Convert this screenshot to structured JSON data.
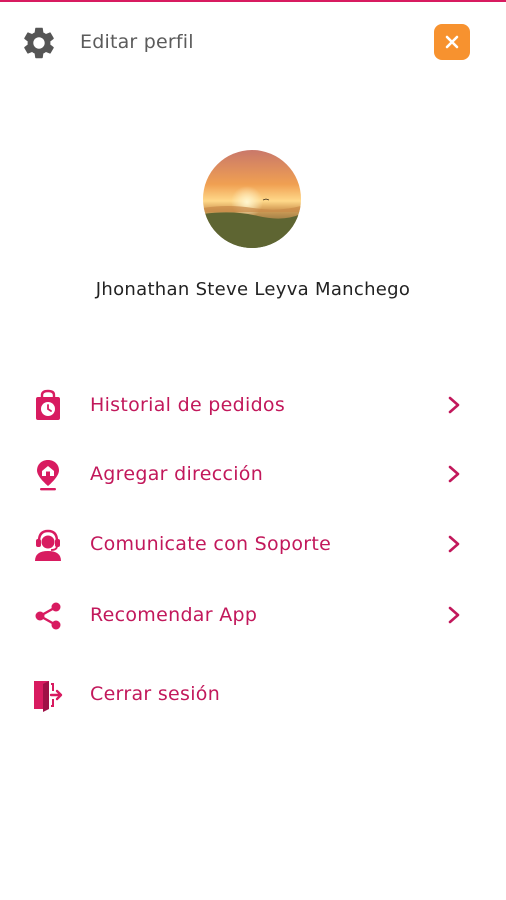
{
  "header": {
    "edit_profile_label": "Editar perfil",
    "settings_icon": "gear-icon",
    "close_icon": "close-icon"
  },
  "profile": {
    "name": "Jhonathan Steve Leyva Manchego",
    "avatar": "sunset-avatar"
  },
  "menu": {
    "items": [
      {
        "label": "Historial de pedidos",
        "icon": "shopping-bag-clock-icon"
      },
      {
        "label": "Agregar dirección",
        "icon": "home-pin-icon"
      },
      {
        "label": "Comunicate con Soporte",
        "icon": "support-agent-icon"
      },
      {
        "label": "Recomendar App",
        "icon": "share-icon"
      }
    ],
    "logout": {
      "label": "Cerrar sesión",
      "icon": "logout-icon"
    }
  },
  "colors": {
    "accent": "#c2185b",
    "icon": "#d81b60",
    "close_button": "#f7922f",
    "text_dark": "#222222",
    "text_muted": "#5b5b5b"
  }
}
